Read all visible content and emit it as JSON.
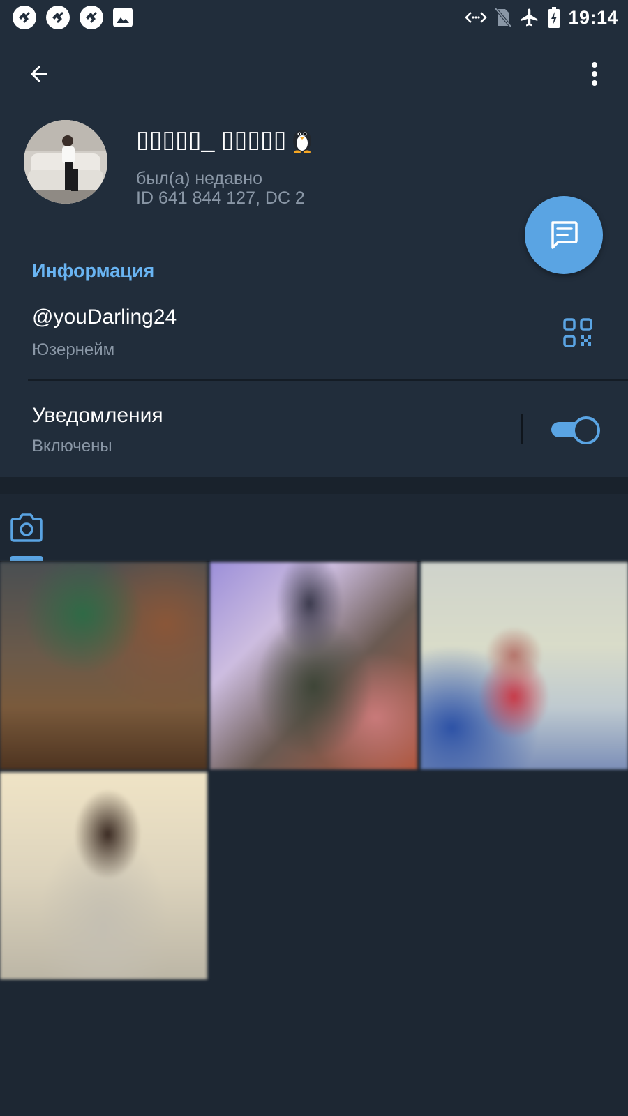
{
  "status_bar": {
    "time": "19:14",
    "notification_icons": [
      "app-notification-icon",
      "app-notification-icon",
      "app-notification-icon",
      "image-icon"
    ],
    "right_icons": [
      "data-transfer-icon",
      "no-sim-icon",
      "airplane-icon",
      "battery-charging-icon"
    ]
  },
  "profile": {
    "name": "▯▯▯▯▯_ ▯▯▯▯▯",
    "name_emoji": "penguin-icon",
    "last_seen": "был(а) недавно",
    "id_line": "ID 641 844 127, DC 2"
  },
  "info": {
    "section_title": "Информация",
    "username": "@youDarling24",
    "username_label": "Юзернейм",
    "notifications_title": "Уведомления",
    "notifications_status": "Включены",
    "notifications_enabled": true
  },
  "media": {
    "active_tab": "photo-icon",
    "thumbnails": 4
  },
  "colors": {
    "accent": "#5aa4e3",
    "section_title": "#69b4f2",
    "background": "#1d2733",
    "header": "#212d3b"
  }
}
